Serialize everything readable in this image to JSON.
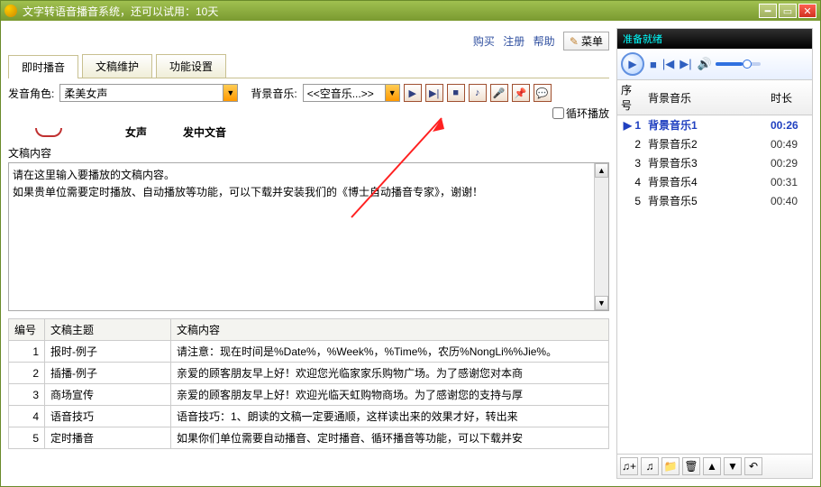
{
  "window": {
    "title": "文字转语音播音系统，还可以试用：10天"
  },
  "toplinks": {
    "buy": "购买",
    "register": "注册",
    "help": "帮助",
    "menu": "菜单"
  },
  "tabs": [
    {
      "label": "即时播音",
      "active": true
    },
    {
      "label": "文稿维护",
      "active": false
    },
    {
      "label": "功能设置",
      "active": false
    }
  ],
  "toolbar": {
    "voice_label": "发音角色:",
    "voice_value": "柔美女声",
    "bg_label": "背景音乐:",
    "bg_value": "<<空音乐...>>",
    "loop_label": "循环播放"
  },
  "row2": {
    "voice_type": "女声",
    "lang": "发中文音"
  },
  "content_label": "文稿内容",
  "textarea_value": "请在这里输入要播放的文稿内容。\n如果贵单位需要定时播放、自动播放等功能，可以下载并安装我们的《博士自动播音专家》，谢谢！",
  "grid": {
    "headers": {
      "num": "编号",
      "topic": "文稿主题",
      "content": "文稿内容"
    },
    "rows": [
      {
        "num": "1",
        "topic": "报时-例子",
        "content": "请注意：现在时间是%Date%，%Week%，%Time%，农历%NongLi%%Jie%。"
      },
      {
        "num": "2",
        "topic": "插播-例子",
        "content": "亲爱的顾客朋友早上好！欢迎您光临家家乐购物广场。为了感谢您对本商"
      },
      {
        "num": "3",
        "topic": "商场宣传",
        "content": "亲爱的顾客朋友早上好！欢迎光临天虹购物商场。为了感谢您的支持与厚"
      },
      {
        "num": "4",
        "topic": "语音技巧",
        "content": "语音技巧：1、朗读的文稿一定要通顺，这样读出来的效果才好，转出来"
      },
      {
        "num": "5",
        "topic": "定时播音",
        "content": "如果你们单位需要自动播音、定时播音、循环播音等功能，可以下载并安"
      }
    ]
  },
  "player": {
    "status": "准备就绪",
    "headers": {
      "num": "序号",
      "name": "背景音乐",
      "dur": "时长"
    },
    "tracks": [
      {
        "num": "1",
        "name": "背景音乐1",
        "dur": "00:26",
        "sel": true
      },
      {
        "num": "2",
        "name": "背景音乐2",
        "dur": "00:49",
        "sel": false
      },
      {
        "num": "3",
        "name": "背景音乐3",
        "dur": "00:29",
        "sel": false
      },
      {
        "num": "4",
        "name": "背景音乐4",
        "dur": "00:31",
        "sel": false
      },
      {
        "num": "5",
        "name": "背景音乐5",
        "dur": "00:40",
        "sel": false
      }
    ]
  },
  "icons": {
    "play": "▶",
    "stop": "■",
    "prev_track": "▶|",
    "note": "♪",
    "mic": "🎤",
    "pin": "📌",
    "bubble": "💬",
    "prev": "|◀",
    "next": "▶|",
    "vol": "🔊",
    "add_note": "♫+",
    "add": "♫",
    "folder": "📁",
    "trash": "🗑",
    "up": "▲",
    "down": "▼",
    "undo": "↶"
  }
}
